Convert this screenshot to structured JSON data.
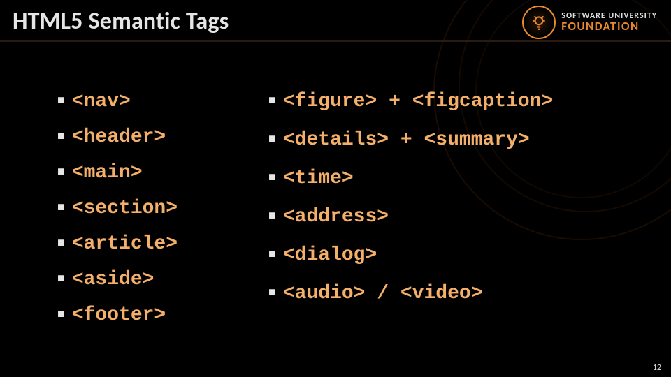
{
  "title": "HTML5 Semantic Tags",
  "logo": {
    "line1": "SOFTWARE UNIVERSITY",
    "line2": "FOUNDATION"
  },
  "left_tags": [
    "<nav>",
    "<header>",
    "<main>",
    "<section>",
    "<article>",
    "<aside>",
    "<footer>"
  ],
  "right_tags": [
    "<figure> + <figcaption>",
    "<details> + <summary>",
    "<time>",
    "<address>",
    "<dialog>",
    "<audio> / <video>"
  ],
  "page_number": "12"
}
